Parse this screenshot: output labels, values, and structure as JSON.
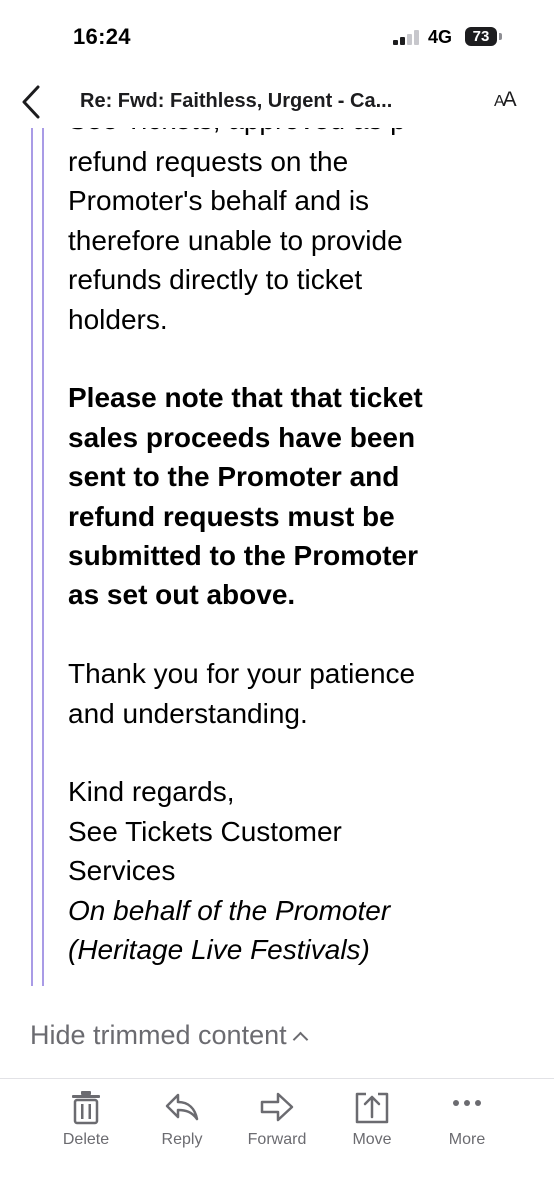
{
  "status_bar": {
    "time": "16:24",
    "network": "4G",
    "battery": "73"
  },
  "nav": {
    "title": "Re: Fwd: Faithless, Urgent - Ca...",
    "text_size_label_big": "A",
    "text_size_label_small": "A"
  },
  "email": {
    "clipped_top": "See Tickets, approved as p",
    "para1": [
      "refund requests on the",
      "Promoter's behalf and is",
      "therefore unable to provide",
      "refunds directly to ticket",
      "holders."
    ],
    "notice": [
      "Please note that that ticket",
      "sales proceeds have been",
      "sent to the Promoter and",
      "refund requests must be",
      "submitted to the Promoter",
      "as set out above."
    ],
    "thanks": [
      "Thank you for your patience",
      "and understanding."
    ],
    "signoff": [
      "Kind regards,",
      "See Tickets Customer",
      "Services"
    ],
    "on_behalf": [
      "On behalf of the Promoter",
      "(Heritage Live Festivals)"
    ]
  },
  "hide_trimmed": "Hide trimmed content",
  "toolbar": {
    "items": [
      {
        "label": "Delete",
        "icon": "trash-icon"
      },
      {
        "label": "Reply",
        "icon": "reply-icon"
      },
      {
        "label": "Forward",
        "icon": "forward-icon"
      },
      {
        "label": "Move",
        "icon": "move-icon"
      },
      {
        "label": "More",
        "icon": "more-icon"
      }
    ]
  },
  "colors": {
    "quote_bar": "#a99be6",
    "icon_gray": "#6b6b70"
  }
}
